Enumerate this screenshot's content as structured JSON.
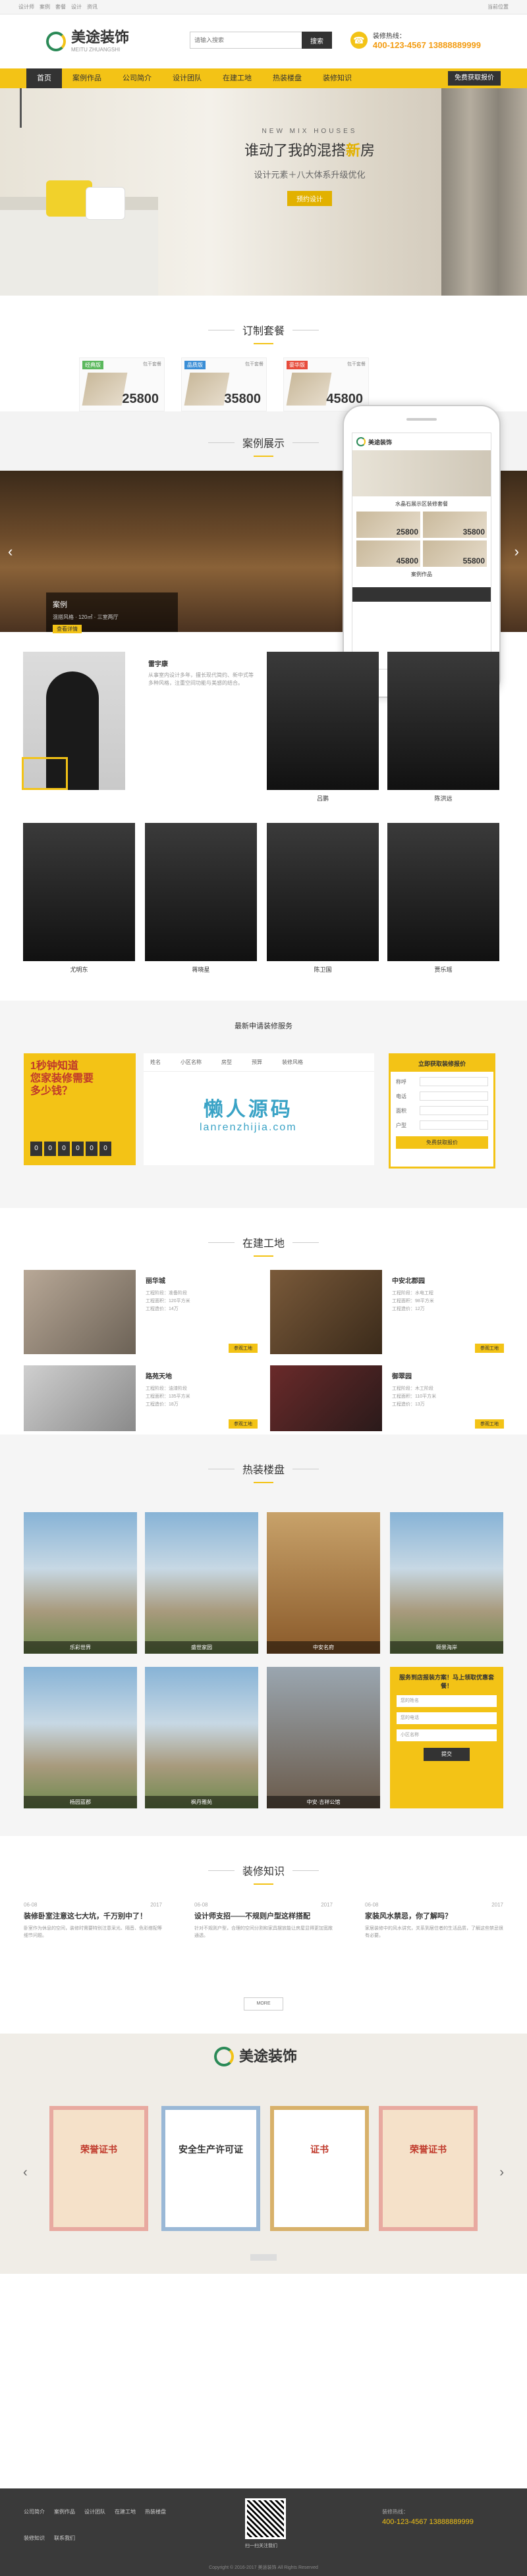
{
  "topbar": {
    "links": [
      "设计师",
      "案例",
      "套餐",
      "设计",
      "资讯"
    ],
    "right": "当前位置"
  },
  "header": {
    "brand": "美途装饰",
    "tagline": "MEITU ZHUANGSHI",
    "search_placeholder": "请输入搜索",
    "search_btn": "搜索",
    "hotline_label": "装修热线：",
    "phone1": "400-123-4567",
    "phone2": "13888889999"
  },
  "nav": {
    "items": [
      "首页",
      "案例作品",
      "公司简介",
      "设计团队",
      "在建工地",
      "热装楼盘",
      "装修知识"
    ],
    "cta": "免费获取报价"
  },
  "banner": {
    "en": "NEW MIX HOUSES",
    "h1_a": "谁动了我的混搭",
    "h1_b": "新",
    "h1_c": "房",
    "h2": "设计元素＋八大体系升级优化",
    "btn": "预约设计"
  },
  "packages": {
    "title": "订制套餐",
    "items": [
      {
        "tag": "经典版",
        "sub": "包干套餐",
        "price": "25800",
        "color": "#5bb85d"
      },
      {
        "tag": "品质版",
        "sub": "包干套餐",
        "price": "35800",
        "color": "#3a8ed6"
      },
      {
        "tag": "豪华版",
        "sub": "包干套餐",
        "price": "45800",
        "color": "#e74c3c"
      }
    ]
  },
  "cases": {
    "title": "案例展示",
    "caption_name": "案例",
    "caption_desc": "混搭风格 · 120㎡ · 三室两厅",
    "caption_btn": "查看详情",
    "prev": "‹",
    "next": "›"
  },
  "phone_mock": {
    "brand": "美途装饰",
    "title": "水晶石展示区装修套餐",
    "prices": [
      "25800",
      "35800",
      "45800",
      "55800"
    ],
    "footer": "案例作品"
  },
  "designers": {
    "feature_name": "雷宇康",
    "feature_desc": "从事室内设计多年，擅长现代简约、新中式等多种风格，注重空间功能与美感的结合。",
    "cards": [
      {
        "name": "吕鹏"
      },
      {
        "name": "陈洪远"
      },
      {
        "name": "尤明东"
      },
      {
        "name": "蒋晓星"
      },
      {
        "name": "陈卫国"
      },
      {
        "name": "贾乐瑶"
      }
    ]
  },
  "apply": {
    "title": "最新申请装修服务",
    "poster_q1": "1秒钟知道",
    "poster_q2": "您家装修需要",
    "poster_q3": "多少钱？",
    "digits": [
      "0",
      "0",
      "0",
      "0",
      "0",
      "0"
    ],
    "tabs": [
      "姓名",
      "小区名称",
      "房型",
      "预算",
      "装修风格"
    ],
    "watermark_a": "懒人源码",
    "watermark_b": "lanrenzhijia.com",
    "form_title": "立即获取装修报价",
    "rows": [
      "称呼",
      "电话",
      "面积",
      "户型"
    ],
    "submit": "免费获取报价"
  },
  "sites": {
    "title": "在建工地",
    "items": [
      {
        "name": "丽华城",
        "info1": "工程阶段：准备阶段",
        "info2": "工程面积：120平方米",
        "info3": "工程造价：14万",
        "btn": "参观工地"
      },
      {
        "name": "中安北郡园",
        "info1": "工程阶段：水电工程",
        "info2": "工程面积：98平方米",
        "info3": "工程造价：12万",
        "btn": "参观工地"
      },
      {
        "name": "路苑天地",
        "info1": "工程阶段：油漆阶段",
        "info2": "工程面积：135平方米",
        "info3": "工程造价：18万",
        "btn": "参观工地"
      },
      {
        "name": "御翠园",
        "info1": "工程阶段：木工阶段",
        "info2": "工程面积：110平方米",
        "info3": "工程造价：13万",
        "btn": "参观工地"
      }
    ]
  },
  "buildings": {
    "title": "热装楼盘",
    "items": [
      "乐彩世界",
      "盛世家园",
      "中安名府",
      "颐景海岸",
      "杨园蓝郡",
      "枫丹雅苑",
      "中安·吉祥公馆"
    ],
    "form_title": "服务到店报装方案！马上领取优惠套餐！",
    "form_inputs": [
      "您的姓名",
      "您的电话",
      "小区名称"
    ],
    "submit": "提交"
  },
  "knowledge": {
    "title": "装修知识",
    "more": "MORE",
    "articles": [
      {
        "date": "06-08",
        "year": "2017",
        "title": "装修卧室注意这七大坑，千万别中了！",
        "desc": "卧室作为休息的空间，装修时需要特别注意采光、隔音、色彩搭配等细节问题。"
      },
      {
        "date": "06-08",
        "year": "2017",
        "title": "设计师支招——不规则户型这样搭配",
        "desc": "针对不规则户型，合理的空间分割和家具摆放能让房屋显得更加宽敞通透。"
      },
      {
        "date": "06-08",
        "year": "2017",
        "title": "家装风水禁忌，你了解吗？",
        "desc": "家居装修中的风水讲究，关系到居住者的生活品质，了解这些禁忌很有必要。"
      }
    ]
  },
  "honor": {
    "brand": "美途装饰",
    "certs": [
      "荣誉证书",
      "安全生产许可证",
      "证书",
      "荣誉证书"
    ],
    "prev": "‹",
    "next": "›"
  },
  "footer": {
    "links": [
      "公司简介",
      "案例作品",
      "设计团队",
      "在建工地",
      "热装楼盘"
    ],
    "links2": [
      "装修知识",
      "联系我们"
    ],
    "qr_label": "扫一扫关注我们",
    "contact_label": "装修热线：",
    "phone": "400-123-4567  13888889999",
    "copy": "Copyright © 2016-2017 美途装饰 All Rights Reserved"
  }
}
